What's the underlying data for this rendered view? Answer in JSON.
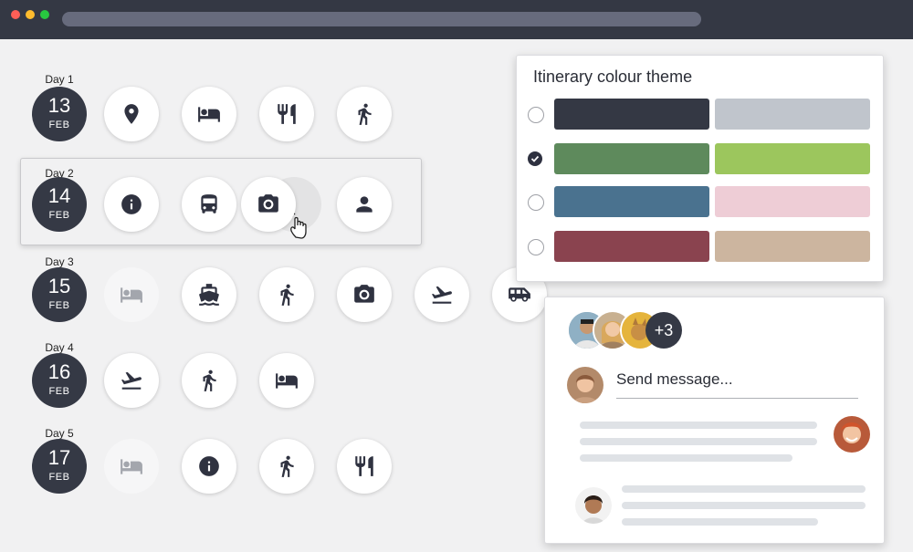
{
  "window": {
    "buttons": [
      "close",
      "minimize",
      "maximize"
    ],
    "colors": {
      "close": "#ff5f57",
      "minimize": "#febc2e",
      "maximize": "#28c840",
      "bar": "#343844",
      "address": "#676b7d"
    }
  },
  "days": [
    {
      "label": "Day 1",
      "day": "13",
      "month": "FEB",
      "activities": [
        {
          "icon": "location-pin-icon"
        },
        {
          "icon": "bed-icon"
        },
        {
          "icon": "restaurant-icon"
        },
        {
          "icon": "walking-icon"
        }
      ]
    },
    {
      "label": "Day 2",
      "day": "14",
      "month": "FEB",
      "dragging": true,
      "activities": [
        {
          "icon": "info-icon"
        },
        {
          "icon": "bus-icon"
        },
        {
          "icon": "camera-icon"
        },
        {
          "icon": "person-icon"
        }
      ]
    },
    {
      "label": "Day 3",
      "day": "15",
      "month": "FEB",
      "activities": [
        {
          "icon": "bed-icon",
          "faded": true
        },
        {
          "icon": "ferry-icon"
        },
        {
          "icon": "walking-icon"
        },
        {
          "icon": "camera-icon"
        },
        {
          "icon": "airplane-takeoff-icon"
        },
        {
          "icon": "van-icon"
        }
      ]
    },
    {
      "label": "Day 4",
      "day": "16",
      "month": "FEB",
      "activities": [
        {
          "icon": "airplane-takeoff-icon"
        },
        {
          "icon": "walking-icon"
        },
        {
          "icon": "bed-icon"
        }
      ]
    },
    {
      "label": "Day 5",
      "day": "17",
      "month": "FEB",
      "activities": [
        {
          "icon": "bed-icon",
          "faded": true
        },
        {
          "icon": "info-icon"
        },
        {
          "icon": "walking-icon"
        },
        {
          "icon": "restaurant-icon"
        }
      ]
    }
  ],
  "theme": {
    "title": "Itinerary colour theme",
    "options": [
      {
        "primary": "#343844",
        "secondary": "#c0c5cc",
        "selected": false
      },
      {
        "primary": "#5e8a5c",
        "secondary": "#9cc65d",
        "selected": true
      },
      {
        "primary": "#4a728f",
        "secondary": "#eecdd6",
        "selected": false
      },
      {
        "primary": "#8a434f",
        "secondary": "#ccb59f",
        "selected": false
      }
    ]
  },
  "chat": {
    "more_count": "+3",
    "placeholder": "Send message..."
  }
}
